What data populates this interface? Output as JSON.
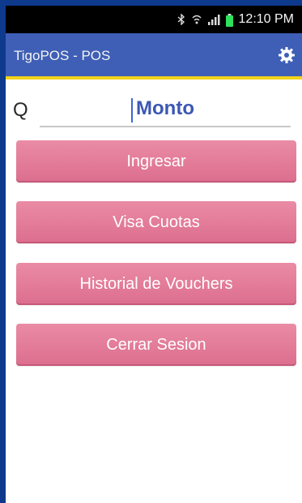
{
  "status_bar": {
    "time": "12:10 PM",
    "icons": [
      "bluetooth-icon",
      "wifi-icon",
      "signal-icon",
      "battery-icon"
    ]
  },
  "app_bar": {
    "title": "TigoPOS - POS",
    "settings_icon": "gear-icon",
    "background_color": "#3f5fb6",
    "accent_color": "#f1d21a"
  },
  "amount": {
    "currency": "Q",
    "placeholder": "Monto",
    "value": ""
  },
  "buttons": [
    {
      "label": "Ingresar"
    },
    {
      "label": "Visa Cuotas"
    },
    {
      "label": "Historial de Vouchers"
    },
    {
      "label": "Cerrar Sesion"
    }
  ],
  "colors": {
    "outer_frame": "#0d3a8c",
    "button": "#e0789a",
    "text_accent": "#3b58b2"
  }
}
